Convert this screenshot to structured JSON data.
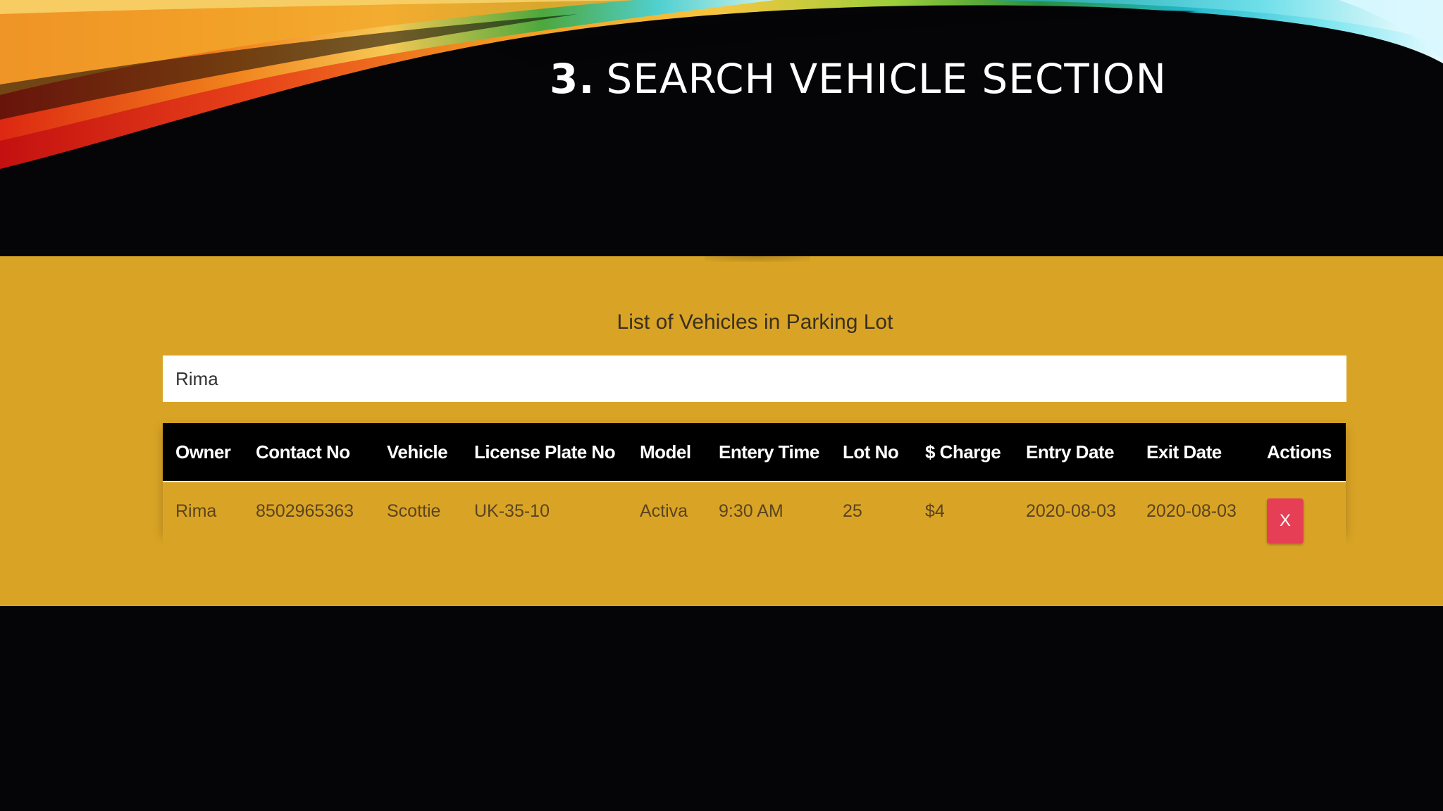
{
  "slide": {
    "title_number": "3.",
    "title_text": "SEARCH VEHICLE SECTION"
  },
  "app": {
    "heading": "List of Vehicles in Parking Lot",
    "search": {
      "value": "Rima",
      "placeholder": ""
    },
    "table": {
      "columns": [
        "Owner",
        "Contact No",
        "Vehicle",
        "License Plate No",
        "Model",
        "Entery Time",
        "Lot No",
        "$ Charge",
        "Entry Date",
        "Exit Date",
        "Actions"
      ],
      "rows": [
        {
          "owner": "Rima",
          "contact": "8502965363",
          "vehicle": "Scottie",
          "plate": "UK-35-10",
          "model": "Activa",
          "entry_time": "9:30 AM",
          "lot_no": "25",
          "charge": "$4",
          "entry_date": "2020-08-03",
          "exit_date": "2020-08-03",
          "action_label": "X"
        }
      ]
    }
  },
  "colors": {
    "background": "#050406",
    "panel": "#d9a425",
    "header_row": "#000000",
    "delete_button": "#e63e55",
    "title_text": "#ffffff"
  }
}
